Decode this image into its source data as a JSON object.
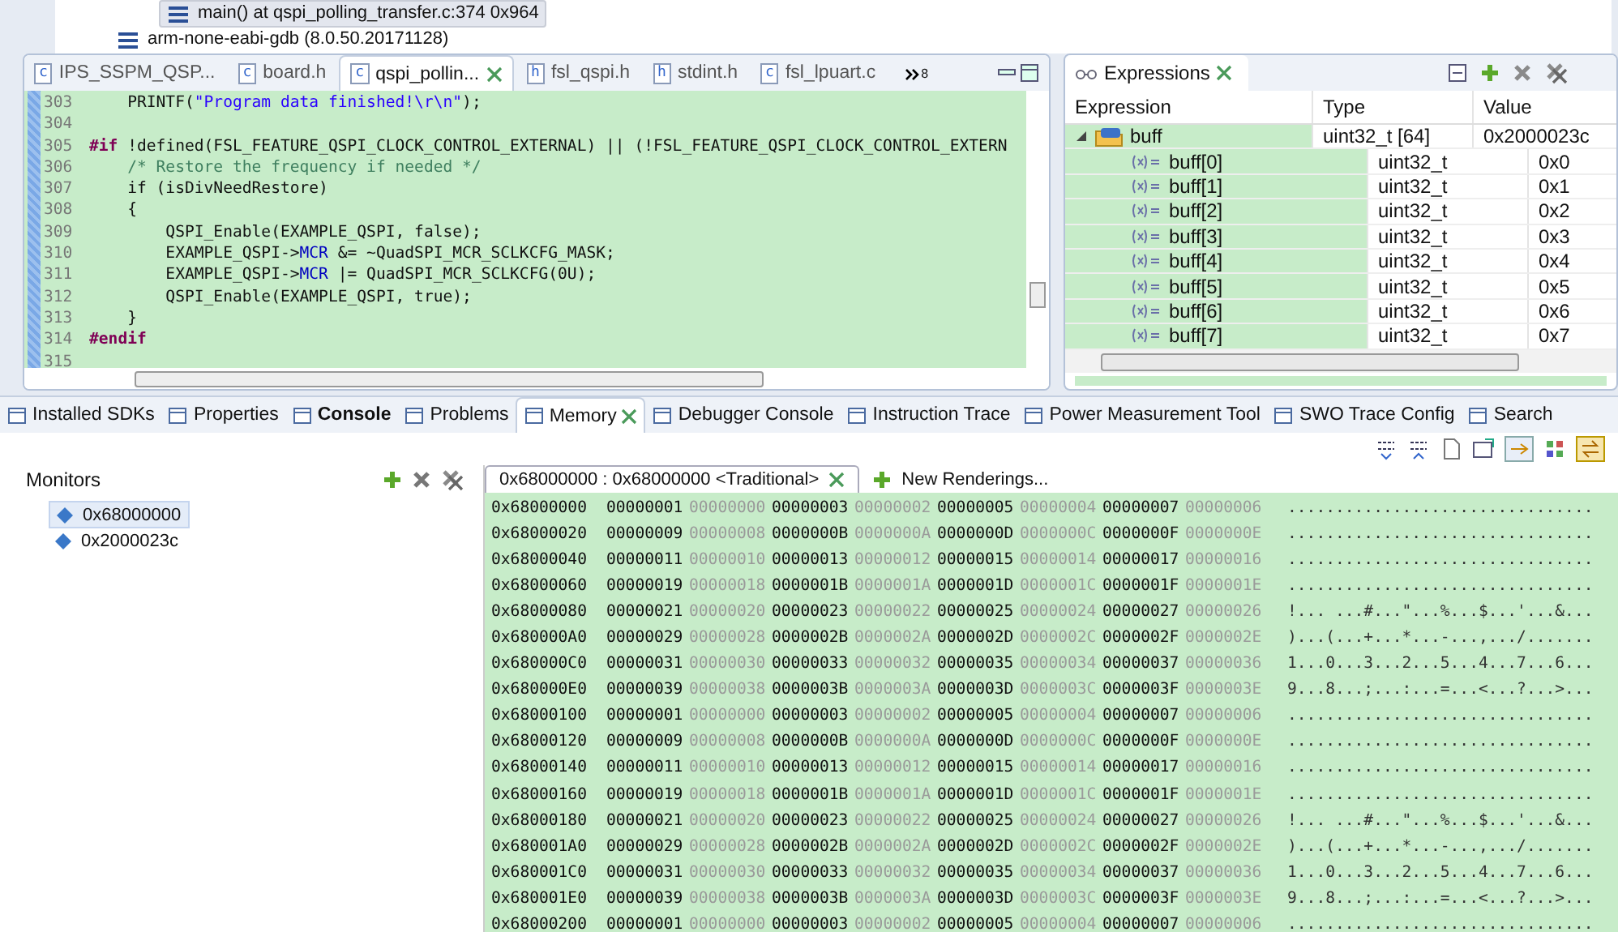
{
  "debug_tree": [
    {
      "label": "main() at qspi_polling_transfer.c:374 0x964",
      "selected": true
    },
    {
      "label": "arm-none-eabi-gdb (8.0.50.20171128)",
      "selected": false
    }
  ],
  "editor": {
    "tabs": [
      {
        "label": "IPS_SSPM_QSP...",
        "file_type": "c",
        "selected": false
      },
      {
        "label": "board.h",
        "file_type": "c",
        "selected": false
      },
      {
        "label": "qspi_pollin...",
        "file_type": "c",
        "selected": true
      },
      {
        "label": "fsl_qspi.h",
        "file_type": "h",
        "selected": false
      },
      {
        "label": "stdint.h",
        "file_type": "h",
        "selected": false
      },
      {
        "label": "fsl_lpuart.c",
        "file_type": "c",
        "selected": false
      }
    ],
    "overflow_count": "8",
    "lines": [
      {
        "number": "303",
        "segments": [
          {
            "text": "    PRINTF(",
            "kind": "plain"
          },
          {
            "text": "\"Program data finished!\\r\\n\"",
            "kind": "string"
          },
          {
            "text": ");",
            "kind": "plain"
          }
        ]
      },
      {
        "number": "304"
      },
      {
        "number": "305",
        "segments": [
          {
            "text": "#if",
            "kind": "keyword"
          },
          {
            "text": " !defined(FSL_FEATURE_QSPI_CLOCK_CONTROL_EXTERNAL) || (!FSL_FEATURE_QSPI_CLOCK_CONTROL_EXTERN",
            "kind": "plain"
          }
        ]
      },
      {
        "number": "306",
        "segments": [
          {
            "text": "    /* Restore the frequency if needed */",
            "kind": "comment"
          }
        ]
      },
      {
        "number": "307",
        "segments": [
          {
            "text": "    if (isDivNeedRestore)",
            "kind": "plain"
          }
        ]
      },
      {
        "number": "308",
        "segments": [
          {
            "text": "    {",
            "kind": "plain"
          }
        ]
      },
      {
        "number": "309",
        "segments": [
          {
            "text": "        QSPI_Enable(EXAMPLE_QSPI, false);",
            "kind": "plain"
          }
        ]
      },
      {
        "number": "310",
        "segments": [
          {
            "text": "        EXAMPLE_QSPI->",
            "kind": "plain"
          },
          {
            "text": "MCR",
            "kind": "field"
          },
          {
            "text": " &= ~QuadSPI_MCR_SCLKCFG_MASK;",
            "kind": "plain"
          }
        ]
      },
      {
        "number": "311",
        "segments": [
          {
            "text": "        EXAMPLE_QSPI->",
            "kind": "plain"
          },
          {
            "text": "MCR",
            "kind": "field"
          },
          {
            "text": " |= QuadSPI_MCR_SCLKCFG(0U);",
            "kind": "plain"
          }
        ]
      },
      {
        "number": "312",
        "segments": [
          {
            "text": "        QSPI_Enable(EXAMPLE_QSPI, true);",
            "kind": "plain"
          }
        ]
      },
      {
        "number": "313",
        "segments": [
          {
            "text": "    }",
            "kind": "plain"
          }
        ]
      },
      {
        "number": "314",
        "segments": [
          {
            "text": "#endif",
            "kind": "keyword"
          }
        ]
      },
      {
        "number": "315"
      }
    ]
  },
  "expressions": {
    "title": "Expressions",
    "columns": [
      "Expression",
      "Type",
      "Value"
    ],
    "rows": [
      {
        "name": "buff",
        "type": "uint32_t [64]",
        "value": "0x2000023c",
        "expanded": true,
        "children": [
          {
            "name": "buff[0]",
            "type": "uint32_t",
            "value": "0x0"
          },
          {
            "name": "buff[1]",
            "type": "uint32_t",
            "value": "0x1"
          },
          {
            "name": "buff[2]",
            "type": "uint32_t",
            "value": "0x2"
          },
          {
            "name": "buff[3]",
            "type": "uint32_t",
            "value": "0x3"
          },
          {
            "name": "buff[4]",
            "type": "uint32_t",
            "value": "0x4"
          },
          {
            "name": "buff[5]",
            "type": "uint32_t",
            "value": "0x5"
          },
          {
            "name": "buff[6]",
            "type": "uint32_t",
            "value": "0x6"
          },
          {
            "name": "buff[7]",
            "type": "uint32_t",
            "value": "0x7"
          }
        ]
      }
    ]
  },
  "bottom_tabs": [
    {
      "label": "Installed SDKs",
      "bold": false,
      "selected": false
    },
    {
      "label": "Properties",
      "bold": false,
      "selected": false
    },
    {
      "label": "Console",
      "bold": true,
      "selected": false
    },
    {
      "label": "Problems",
      "bold": false,
      "selected": false
    },
    {
      "label": "Memory",
      "bold": false,
      "selected": true
    },
    {
      "label": "Debugger Console",
      "bold": false,
      "selected": false
    },
    {
      "label": "Instruction Trace",
      "bold": false,
      "selected": false
    },
    {
      "label": "Power Measurement Tool",
      "bold": false,
      "selected": false
    },
    {
      "label": "SWO Trace Config",
      "bold": false,
      "selected": false
    },
    {
      "label": "Search",
      "bold": false,
      "selected": false
    }
  ],
  "monitors": {
    "title": "Monitors",
    "items": [
      {
        "label": "0x68000000",
        "selected": true
      },
      {
        "label": "0x2000023c",
        "selected": false
      }
    ]
  },
  "memory": {
    "renderings": [
      {
        "label": "0x68000000 : 0x68000000 <Traditional>",
        "kind": "rendering"
      },
      {
        "label": "New Renderings...",
        "kind": "add"
      }
    ],
    "columns": [
      {
        "bold": true
      },
      {
        "bold": false
      },
      {
        "bold": true
      },
      {
        "bold": false
      },
      {
        "bold": true
      },
      {
        "bold": false
      },
      {
        "bold": true
      },
      {
        "bold": false
      }
    ],
    "rows": [
      {
        "address": "0x68000000",
        "words": [
          "00000001",
          "00000000",
          "00000003",
          "00000002",
          "00000005",
          "00000004",
          "00000007",
          "00000006"
        ],
        "ascii": "................................"
      },
      {
        "address": "0x68000020",
        "words": [
          "00000009",
          "00000008",
          "0000000B",
          "0000000A",
          "0000000D",
          "0000000C",
          "0000000F",
          "0000000E"
        ],
        "ascii": "................................"
      },
      {
        "address": "0x68000040",
        "words": [
          "00000011",
          "00000010",
          "00000013",
          "00000012",
          "00000015",
          "00000014",
          "00000017",
          "00000016"
        ],
        "ascii": "................................"
      },
      {
        "address": "0x68000060",
        "words": [
          "00000019",
          "00000018",
          "0000001B",
          "0000001A",
          "0000001D",
          "0000001C",
          "0000001F",
          "0000001E"
        ],
        "ascii": "................................"
      },
      {
        "address": "0x68000080",
        "words": [
          "00000021",
          "00000020",
          "00000023",
          "00000022",
          "00000025",
          "00000024",
          "00000027",
          "00000026"
        ],
        "ascii": "!... ...#...\"...%...$...'...&..."
      },
      {
        "address": "0x680000A0",
        "words": [
          "00000029",
          "00000028",
          "0000002B",
          "0000002A",
          "0000002D",
          "0000002C",
          "0000002F",
          "0000002E"
        ],
        "ascii": ")...(...+...*...-...,.../......."
      },
      {
        "address": "0x680000C0",
        "words": [
          "00000031",
          "00000030",
          "00000033",
          "00000032",
          "00000035",
          "00000034",
          "00000037",
          "00000036"
        ],
        "ascii": "1...0...3...2...5...4...7...6..."
      },
      {
        "address": "0x680000E0",
        "words": [
          "00000039",
          "00000038",
          "0000003B",
          "0000003A",
          "0000003D",
          "0000003C",
          "0000003F",
          "0000003E"
        ],
        "ascii": "9...8...;...:...=...<...?...>..."
      },
      {
        "address": "0x68000100",
        "words": [
          "00000001",
          "00000000",
          "00000003",
          "00000002",
          "00000005",
          "00000004",
          "00000007",
          "00000006"
        ],
        "ascii": "................................"
      },
      {
        "address": "0x68000120",
        "words": [
          "00000009",
          "00000008",
          "0000000B",
          "0000000A",
          "0000000D",
          "0000000C",
          "0000000F",
          "0000000E"
        ],
        "ascii": "................................"
      },
      {
        "address": "0x68000140",
        "words": [
          "00000011",
          "00000010",
          "00000013",
          "00000012",
          "00000015",
          "00000014",
          "00000017",
          "00000016"
        ],
        "ascii": "................................"
      },
      {
        "address": "0x68000160",
        "words": [
          "00000019",
          "00000018",
          "0000001B",
          "0000001A",
          "0000001D",
          "0000001C",
          "0000001F",
          "0000001E"
        ],
        "ascii": "................................"
      },
      {
        "address": "0x68000180",
        "words": [
          "00000021",
          "00000020",
          "00000023",
          "00000022",
          "00000025",
          "00000024",
          "00000027",
          "00000026"
        ],
        "ascii": "!... ...#...\"...%...$...'...&..."
      },
      {
        "address": "0x680001A0",
        "words": [
          "00000029",
          "00000028",
          "0000002B",
          "0000002A",
          "0000002D",
          "0000002C",
          "0000002F",
          "0000002E"
        ],
        "ascii": ")...(...+...*...-...,.../......."
      },
      {
        "address": "0x680001C0",
        "words": [
          "00000031",
          "00000030",
          "00000033",
          "00000032",
          "00000035",
          "00000034",
          "00000037",
          "00000036"
        ],
        "ascii": "1...0...3...2...5...4...7...6..."
      },
      {
        "address": "0x680001E0",
        "words": [
          "00000039",
          "00000038",
          "0000003B",
          "0000003A",
          "0000003D",
          "0000003C",
          "0000003F",
          "0000003E"
        ],
        "ascii": "9...8...;...:...=...<...?...>..."
      },
      {
        "address": "0x68000200",
        "words": [
          "00000001",
          "00000000",
          "00000003",
          "00000002",
          "00000005",
          "00000004",
          "00000007",
          "00000006"
        ],
        "ascii": "................................"
      }
    ]
  }
}
